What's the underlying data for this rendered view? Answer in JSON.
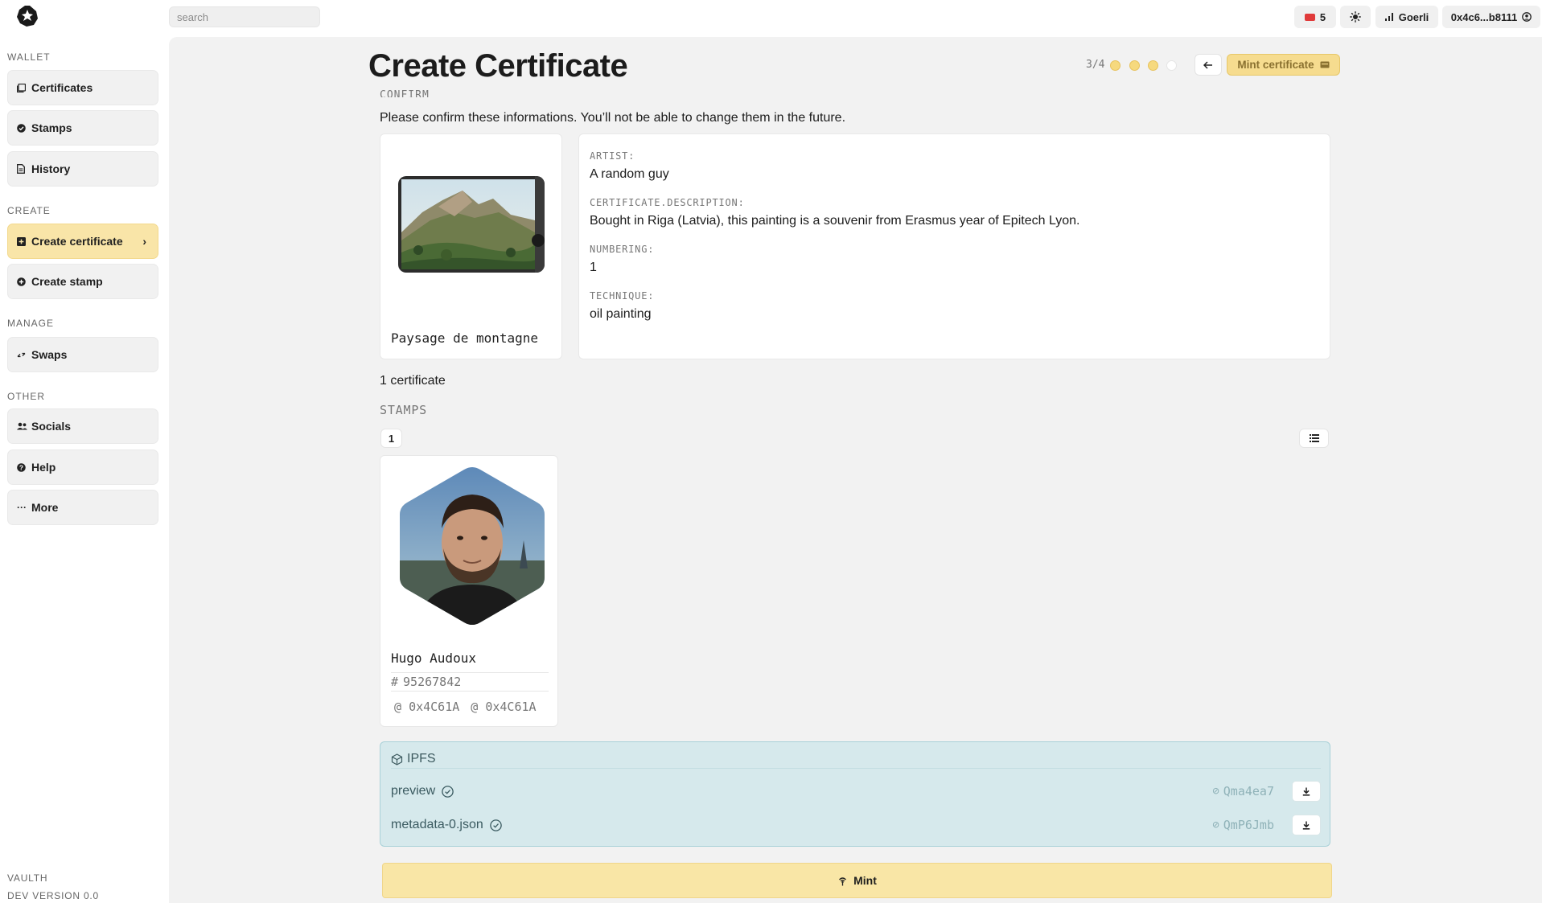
{
  "topbar": {
    "search_placeholder": "search",
    "notifications": "5",
    "network": "Goerli",
    "account": "0x4c6...b8111"
  },
  "sidebar": {
    "sections": [
      {
        "title": "WALLET",
        "items": [
          {
            "label": "Certificates",
            "icon": "certificates-icon"
          },
          {
            "label": "Stamps",
            "icon": "stamp-icon"
          },
          {
            "label": "History",
            "icon": "history-icon"
          }
        ]
      },
      {
        "title": "CREATE",
        "items": [
          {
            "label": "Create certificate",
            "icon": "plus-square-icon",
            "active": true
          },
          {
            "label": "Create stamp",
            "icon": "plus-circle-icon"
          }
        ]
      },
      {
        "title": "MANAGE",
        "items": [
          {
            "label": "Swaps",
            "icon": "swap-icon"
          }
        ]
      },
      {
        "title": "OTHER",
        "items": [
          {
            "label": "Socials",
            "icon": "users-icon"
          },
          {
            "label": "Help",
            "icon": "help-icon"
          },
          {
            "label": "More",
            "icon": "more-icon"
          }
        ]
      }
    ],
    "footer": {
      "app_name": "VAULTH",
      "version": "DEV VERSION 0.0"
    }
  },
  "header": {
    "title": "Create Certificate",
    "step": "3/4",
    "steps_total": 4,
    "steps_done": 3,
    "mint_label": "Mint certificate"
  },
  "confirm": {
    "label": "CONFIRM",
    "text": "Please confirm these informations. You’ll not be able to change them in the future."
  },
  "certificate": {
    "title": "Paysage de montagne",
    "fields": [
      {
        "label": "ARTIST:",
        "value": "A random guy"
      },
      {
        "label": "CERTIFICATE.DESCRIPTION:",
        "value": "Bought in Riga (Latvia), this painting is a souvenir from Erasmus year of Epitech Lyon."
      },
      {
        "label": "NUMBERING:",
        "value": "1"
      },
      {
        "label": "TECHNIQUE:",
        "value": "oil painting"
      }
    ],
    "count": "1 certificate"
  },
  "stamps": {
    "label": "STAMPS",
    "count": "1",
    "items": [
      {
        "name": "Hugo Audoux",
        "id": "95267842",
        "addresses": [
          "0x4C61A",
          "0x4C61A"
        ]
      }
    ]
  },
  "ipfs": {
    "title": "IPFS",
    "files": [
      {
        "name": "preview",
        "cid": "Qma4ea7"
      },
      {
        "name": "metadata-0.json",
        "cid": "QmP6Jmb"
      }
    ]
  },
  "mint_button": "Mint",
  "colors": {
    "accent": "#f6dc8f",
    "ipfs_bg": "#d6e9ec",
    "main_bg": "#f2f2f2"
  }
}
